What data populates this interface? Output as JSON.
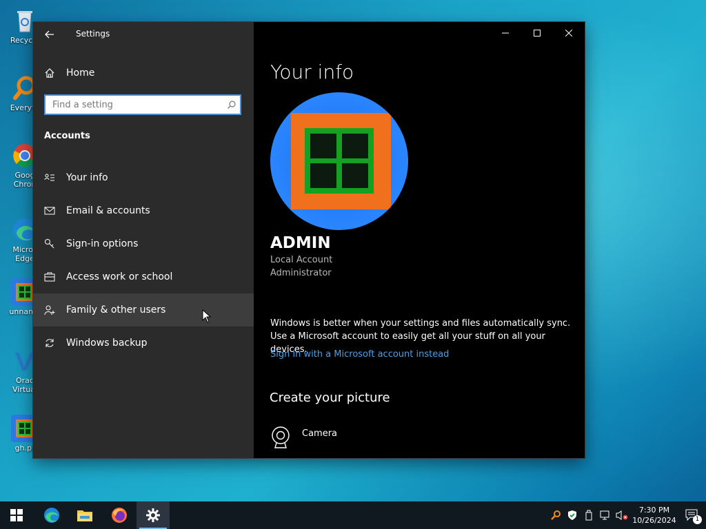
{
  "desktop": {
    "icons": [
      {
        "label": "Recycle"
      },
      {
        "label": "Everyth"
      },
      {
        "label": "Goog Chron"
      },
      {
        "label": "Micros Edge"
      },
      {
        "label": "unname"
      },
      {
        "label": "Orac Virtual"
      },
      {
        "label": "gh.pr"
      }
    ]
  },
  "window": {
    "title": "Settings",
    "nav": {
      "home_label": "Home",
      "search_placeholder": "Find a setting",
      "section_title": "Accounts",
      "items": [
        {
          "label": "Your info",
          "icon": "your-info-icon"
        },
        {
          "label": "Email & accounts",
          "icon": "mail-icon"
        },
        {
          "label": "Sign-in options",
          "icon": "key-icon"
        },
        {
          "label": "Access work or school",
          "icon": "briefcase-icon"
        },
        {
          "label": "Family & other users",
          "icon": "person-add-icon"
        },
        {
          "label": "Windows backup",
          "icon": "sync-icon"
        }
      ]
    },
    "content": {
      "page_title": "Your info",
      "user_name": "ADMIN",
      "account_type": "Local Account",
      "account_role": "Administrator",
      "sync_line1": "Windows is better when your settings and files automatically sync.",
      "sync_line2": "Use a Microsoft account to easily get all your stuff on all your devices.",
      "sign_in_link": "Sign in with a Microsoft account instead",
      "create_picture_title": "Create your picture",
      "camera_label": "Camera"
    }
  },
  "taskbar": {
    "time": "7:30 PM",
    "date": "10/26/2024",
    "notification_count": "1"
  },
  "colors": {
    "accent": "#4aa0e8",
    "nav_bg": "#2b2b2b",
    "content_bg": "#000000",
    "taskbar_bg": "#101820"
  }
}
